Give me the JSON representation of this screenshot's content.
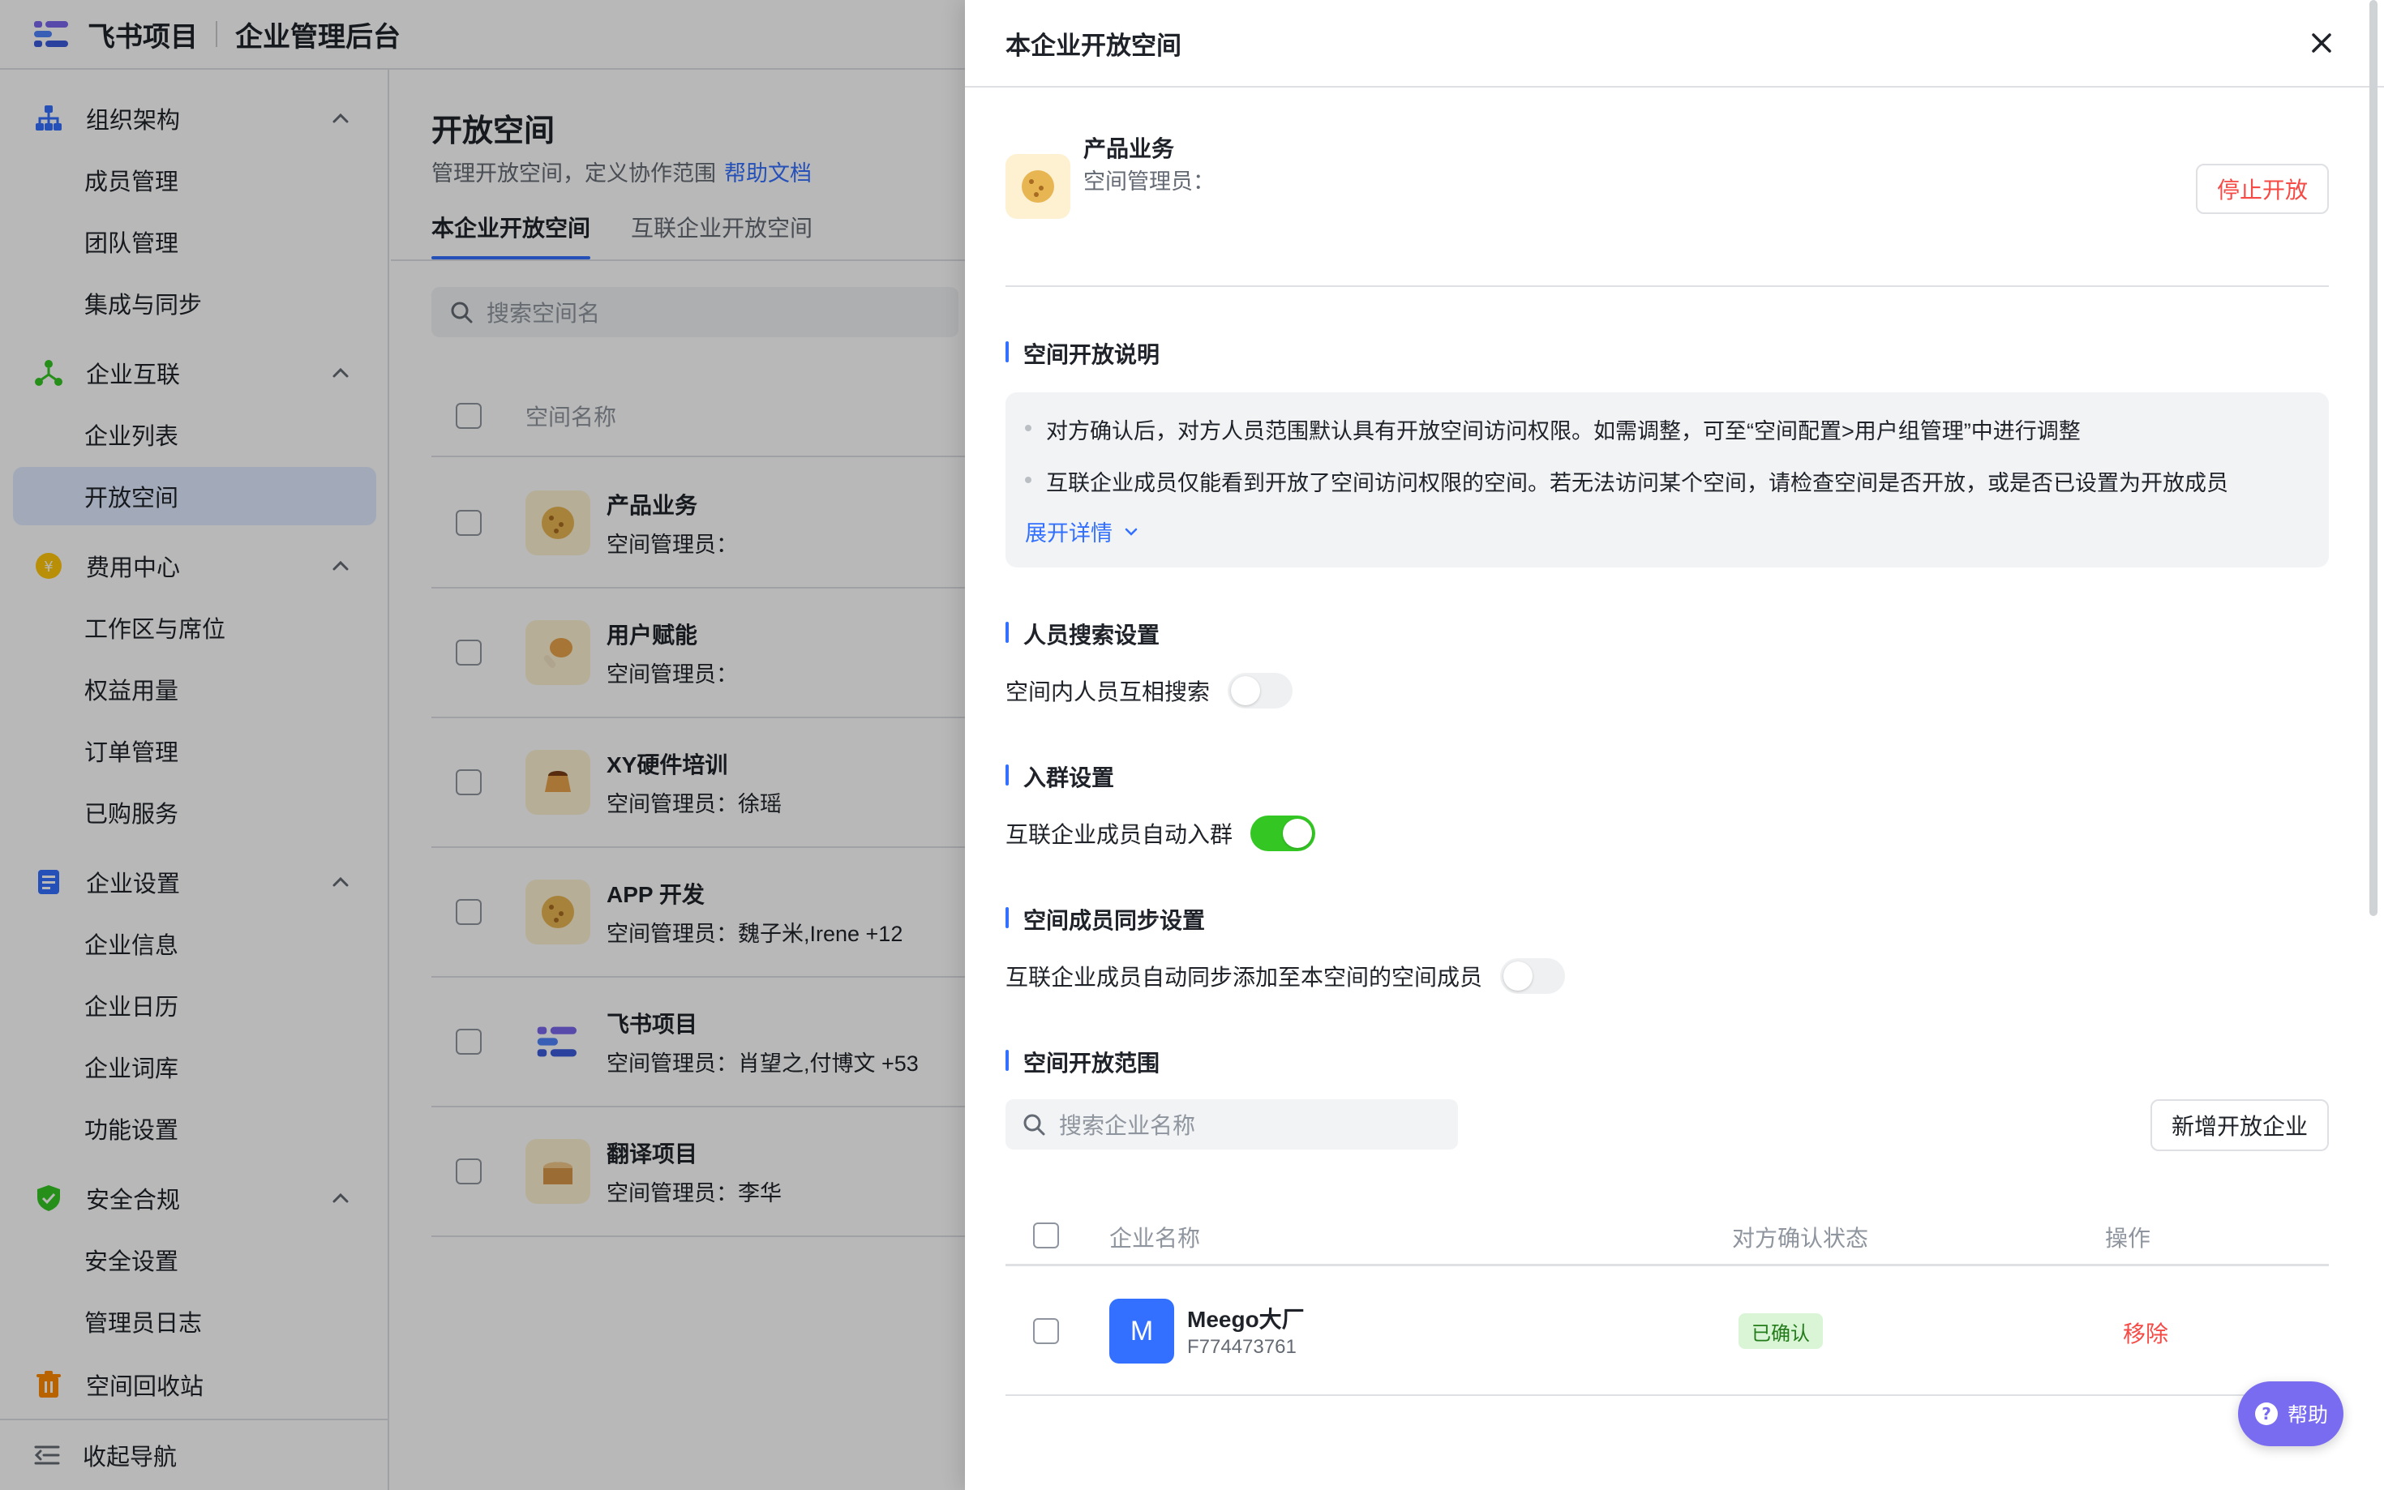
{
  "header": {
    "brand": "飞书项目",
    "admin_title": "企业管理后台"
  },
  "sidebar": {
    "groups": [
      {
        "label": "组织架构",
        "icon": "org-chart-icon",
        "items": [
          "成员管理",
          "团队管理",
          "集成与同步"
        ]
      },
      {
        "label": "企业互联",
        "icon": "connect-icon",
        "items": [
          "企业列表",
          "开放空间"
        ]
      },
      {
        "label": "费用中心",
        "icon": "coin-icon",
        "items": [
          "工作区与席位",
          "权益用量",
          "订单管理",
          "已购服务"
        ]
      },
      {
        "label": "企业设置",
        "icon": "document-icon",
        "items": [
          "企业信息",
          "企业日历",
          "企业词库",
          "功能设置"
        ]
      },
      {
        "label": "安全合规",
        "icon": "shield-check-icon",
        "items": [
          "安全设置",
          "管理员日志"
        ]
      },
      {
        "label": "空间回收站",
        "icon": "trash-icon",
        "items": []
      }
    ],
    "active_item": "开放空间",
    "collapse_label": "收起导航"
  },
  "main": {
    "title": "开放空间",
    "subtitle": "管理开放空间，定义协作范围",
    "help_link": "帮助文档",
    "tabs": [
      "本企业开放空间",
      "互联企业开放空间"
    ],
    "search_placeholder": "搜索空间名",
    "column_header": "空间名称",
    "spaces": [
      {
        "name": "产品业务",
        "admin": "空间管理员：",
        "icon": "cookie-icon"
      },
      {
        "name": "用户赋能",
        "admin": "空间管理员：",
        "icon": "drumstick-icon"
      },
      {
        "name": "XY硬件培训",
        "admin": "空间管理员：徐瑶",
        "icon": "pudding-icon"
      },
      {
        "name": "APP 开发",
        "admin": "空间管理员：魏子米,Irene +12",
        "icon": "cookie-icon"
      },
      {
        "name": "飞书项目",
        "admin": "空间管理员：肖望之,付博文 +53",
        "icon": "meego-logo-icon"
      },
      {
        "name": "翻译项目",
        "admin": "空间管理员：李华",
        "icon": "bread-icon"
      }
    ]
  },
  "drawer": {
    "title": "本企业开放空间",
    "space": {
      "name": "产品业务",
      "admin": "空间管理员："
    },
    "stop_button": "停止开放",
    "sections": {
      "open_note_title": "空间开放说明",
      "notes": [
        "对方确认后，对方人员范围默认具有开放空间访问权限。如需调整，可至“空间配置>用户组管理”中进行调整",
        "互联企业成员仅能看到开放了空间访问权限的空间。若无法访问某个空间，请检查空间是否开放，或是否已设置为开放成员"
      ],
      "expand_label": "展开详情",
      "search_setting_title": "人员搜索设置",
      "search_setting_label": "空间内人员互相搜索",
      "search_setting_on": false,
      "group_setting_title": "入群设置",
      "group_setting_label": "互联企业成员自动入群",
      "group_setting_on": true,
      "sync_setting_title": "空间成员同步设置",
      "sync_setting_label": "互联企业成员自动同步添加至本空间的空间成员",
      "sync_setting_on": false,
      "scope_title": "空间开放范围",
      "scope_search_placeholder": "搜索企业名称",
      "add_button": "新增开放企业"
    },
    "table": {
      "columns": [
        "企业名称",
        "对方确认状态",
        "操作"
      ],
      "rows": [
        {
          "avatar_letter": "M",
          "name": "Meego大厂",
          "id": "F774473761",
          "status": "已确认",
          "action": "移除"
        }
      ]
    }
  },
  "help_fab": "帮助",
  "colors": {
    "accent": "#3370ff",
    "danger": "#f54a45",
    "success": "#34c724",
    "help": "#7a6cf0"
  }
}
